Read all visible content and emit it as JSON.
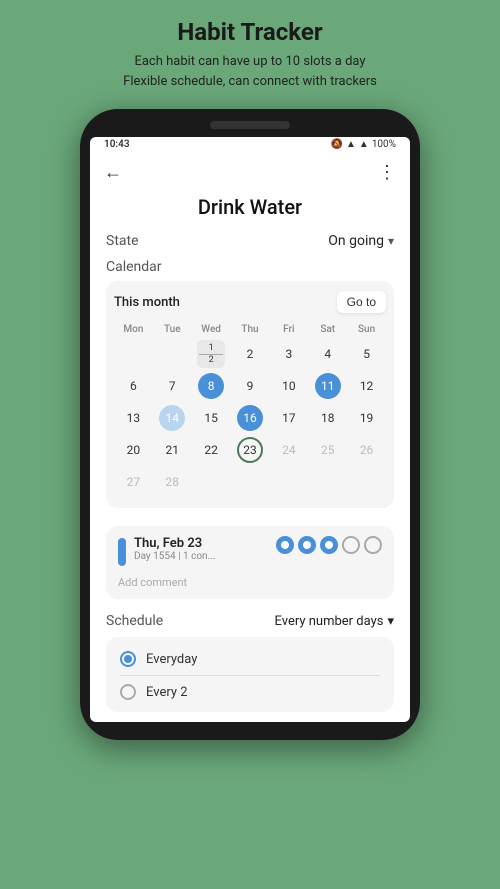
{
  "header": {
    "title": "Habit Tracker",
    "subtitle_line1": "Each habit can have up to 10 slots a day",
    "subtitle_line2": "Flexible schedule, can connect with trackers"
  },
  "statusBar": {
    "time": "10:43",
    "battery": "100%",
    "icons": "🔕 📶"
  },
  "topBar": {
    "back": "←",
    "more": "⋮"
  },
  "habitTitle": "Drink Water",
  "state": {
    "label": "State",
    "value": "On going",
    "dropdown": "▾"
  },
  "calendarSection": {
    "label": "Calendar",
    "thisMonth": "This month",
    "gotoBtn": "Go to",
    "days": [
      "Mon",
      "Tue",
      "Wed",
      "Thu",
      "Fri",
      "Sat",
      "Sun"
    ],
    "weeks": [
      [
        {
          "num": "",
          "type": "empty"
        },
        {
          "num": "",
          "type": "empty"
        },
        {
          "num": "1/2",
          "type": "wed-split"
        },
        {
          "num": "2",
          "type": "normal"
        },
        {
          "num": "3",
          "type": "normal"
        },
        {
          "num": "4",
          "type": "normal"
        },
        {
          "num": "5",
          "type": "normal"
        }
      ],
      [
        {
          "num": "6",
          "type": "normal"
        },
        {
          "num": "7",
          "type": "normal"
        },
        {
          "num": "8",
          "type": "blue"
        },
        {
          "num": "9",
          "type": "normal"
        },
        {
          "num": "10",
          "type": "normal"
        },
        {
          "num": "11",
          "type": "blue"
        },
        {
          "num": "12",
          "type": "normal"
        }
      ],
      [
        {
          "num": "13",
          "type": "normal"
        },
        {
          "num": "14",
          "type": "light-blue"
        },
        {
          "num": "15",
          "type": "normal"
        },
        {
          "num": "16",
          "type": "blue"
        },
        {
          "num": "17",
          "type": "normal"
        },
        {
          "num": "18",
          "type": "normal"
        },
        {
          "num": "19",
          "type": "normal"
        }
      ],
      [
        {
          "num": "20",
          "type": "normal"
        },
        {
          "num": "21",
          "type": "normal"
        },
        {
          "num": "22",
          "type": "normal"
        },
        {
          "num": "23",
          "type": "today"
        },
        {
          "num": "24",
          "type": "gray"
        },
        {
          "num": "25",
          "type": "gray"
        },
        {
          "num": "26",
          "type": "gray"
        }
      ],
      [
        {
          "num": "27",
          "type": "gray"
        },
        {
          "num": "28",
          "type": "gray"
        },
        {
          "num": "",
          "type": "empty"
        },
        {
          "num": "",
          "type": "empty"
        },
        {
          "num": "",
          "type": "empty"
        },
        {
          "num": "",
          "type": "empty"
        },
        {
          "num": "",
          "type": "empty"
        }
      ]
    ]
  },
  "dayDetail": {
    "date": "Thu, Feb 23",
    "subtext": "Day 1554 | 1 con...",
    "circles": [
      "filled",
      "filled",
      "filled",
      "outlined",
      "outlined"
    ],
    "addComment": "Add comment"
  },
  "schedule": {
    "label": "Schedule",
    "value": "Every number days",
    "dropdown": "▾",
    "options": [
      {
        "label": "Everyday",
        "selected": true
      },
      {
        "label": "Every 2",
        "selected": false
      }
    ]
  }
}
